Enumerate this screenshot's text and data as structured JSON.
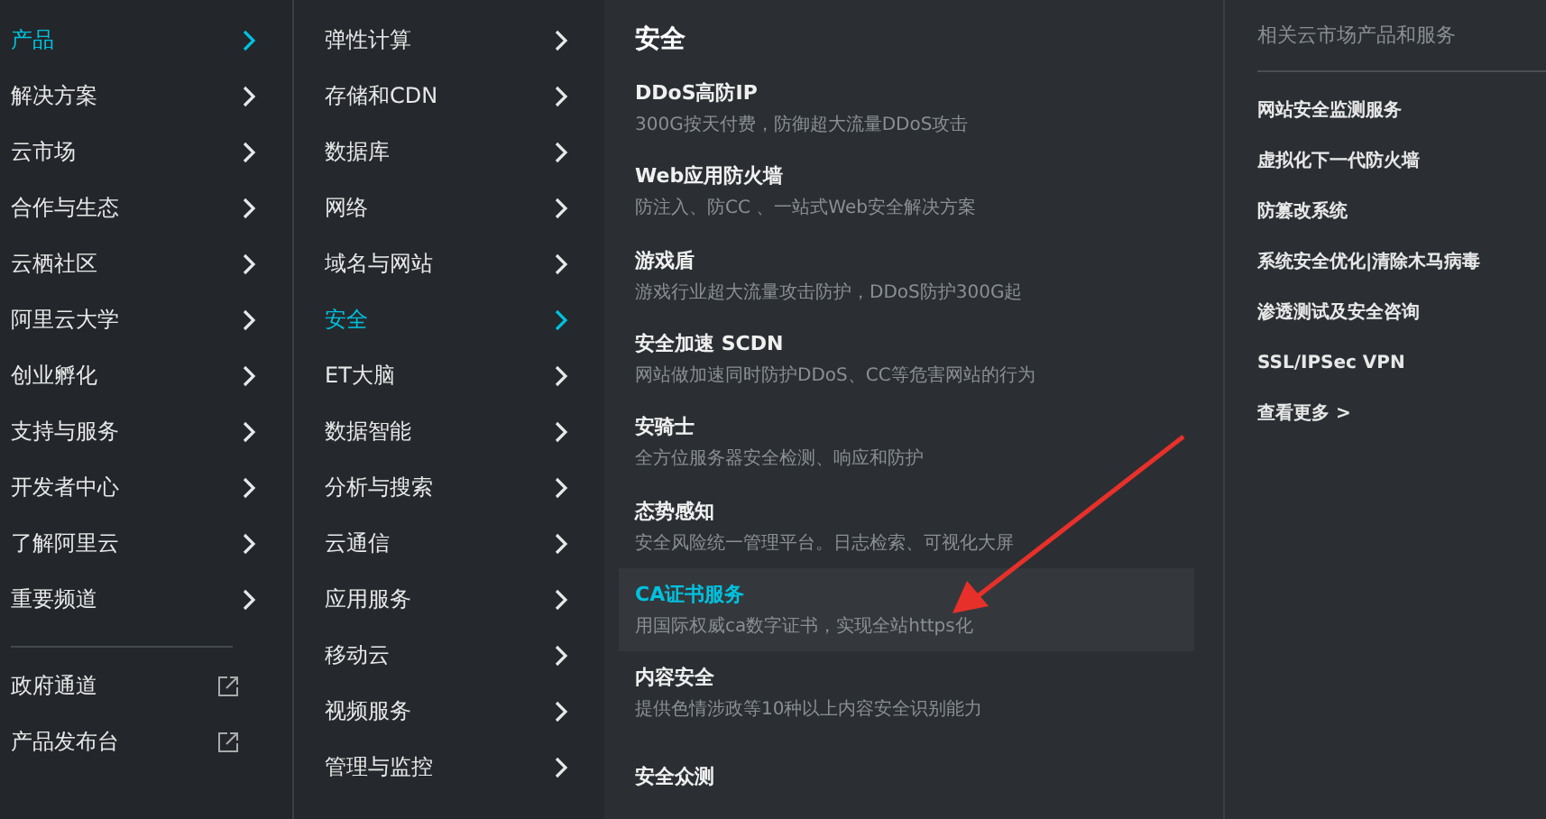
{
  "categories": [
    {
      "label": "产品",
      "selected": true
    },
    {
      "label": "解决方案",
      "selected": false
    },
    {
      "label": "云市场",
      "selected": false
    },
    {
      "label": "合作与生态",
      "selected": false
    },
    {
      "label": "云栖社区",
      "selected": false
    },
    {
      "label": "阿里云大学",
      "selected": false
    },
    {
      "label": "创业孵化",
      "selected": false
    },
    {
      "label": "支持与服务",
      "selected": false
    },
    {
      "label": "开发者中心",
      "selected": false
    },
    {
      "label": "了解阿里云",
      "selected": false
    },
    {
      "label": "重要频道",
      "selected": false
    }
  ],
  "external_links": [
    "政府通道",
    "产品发布台"
  ],
  "product_groups": [
    {
      "label": "弹性计算",
      "selected": false
    },
    {
      "label": "存储和CDN",
      "selected": false
    },
    {
      "label": "数据库",
      "selected": false
    },
    {
      "label": "网络",
      "selected": false
    },
    {
      "label": "域名与网站",
      "selected": false
    },
    {
      "label": "安全",
      "selected": true
    },
    {
      "label": "ET大脑",
      "selected": false
    },
    {
      "label": "数据智能",
      "selected": false
    },
    {
      "label": "分析与搜索",
      "selected": false
    },
    {
      "label": "云通信",
      "selected": false
    },
    {
      "label": "应用服务",
      "selected": false
    },
    {
      "label": "移动云",
      "selected": false
    },
    {
      "label": "视频服务",
      "selected": false
    },
    {
      "label": "管理与监控",
      "selected": false
    }
  ],
  "detail": {
    "title": "安全",
    "items": [
      {
        "name": "DDoS高防IP",
        "description": "300G按天付费，防御超大流量DDoS攻击",
        "selected": false
      },
      {
        "name": "Web应用防火墙",
        "description": "防注入、防CC 、一站式Web安全解决方案",
        "selected": false
      },
      {
        "name": "游戏盾",
        "description": "游戏行业超大流量攻击防护，DDoS防护300G起",
        "selected": false
      },
      {
        "name": "安全加速 SCDN",
        "description": "网站做加速同时防护DDoS、CC等危害网站的行为",
        "selected": false
      },
      {
        "name": "安骑士",
        "description": "全方位服务器安全检测、响应和防护",
        "selected": false
      },
      {
        "name": "态势感知",
        "description": "安全风险统一管理平台。日志检索、可视化大屏",
        "selected": false
      },
      {
        "name": "CA证书服务",
        "description": "用国际权威ca数字证书，实现全站https化",
        "selected": true
      },
      {
        "name": "内容安全",
        "description": "提供色情涉政等10种以上内容安全识别能力",
        "selected": false
      },
      {
        "name": "安全众测",
        "selected": false
      }
    ]
  },
  "related": {
    "title": "相关云市场产品和服务",
    "links": [
      "网站安全监测服务",
      "虚拟化下一代防火墙",
      "防篡改系统",
      "系统安全优化|清除木马病毒",
      "渗透测试及安全咨询",
      "SSL/IPSec VPN",
      "查看更多 >"
    ]
  }
}
